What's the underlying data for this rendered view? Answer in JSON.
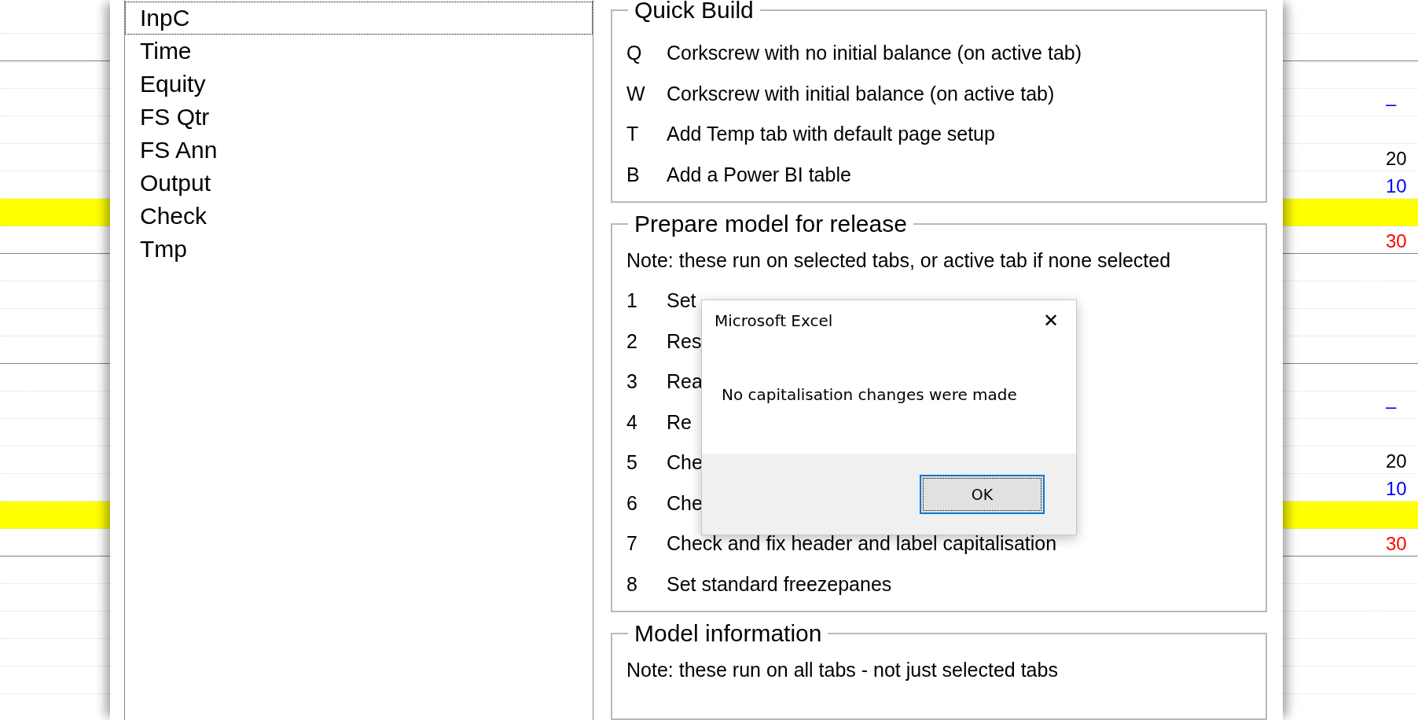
{
  "sheet": {
    "rows": [
      {
        "highlight": false,
        "rule": false
      },
      {
        "highlight": false,
        "rule": true
      },
      {
        "highlight": false,
        "rule": false
      },
      {
        "highlight": false,
        "rule": false,
        "value": "–",
        "color": "#0000ff"
      },
      {
        "highlight": false,
        "rule": false
      },
      {
        "highlight": false,
        "rule": false,
        "value": "20",
        "color": "#000000"
      },
      {
        "highlight": false,
        "rule": false,
        "value": "10",
        "color": "#0000ff"
      },
      {
        "highlight": true,
        "rule": false
      },
      {
        "highlight": false,
        "rule": true,
        "value": "30",
        "color": "#ff0000"
      },
      {
        "highlight": false,
        "rule": false
      },
      {
        "highlight": false,
        "rule": false
      },
      {
        "highlight": false,
        "rule": false
      },
      {
        "highlight": false,
        "rule": true
      },
      {
        "highlight": false,
        "rule": false
      },
      {
        "highlight": false,
        "rule": false,
        "value": "–",
        "color": "#0000ff"
      },
      {
        "highlight": false,
        "rule": false
      },
      {
        "highlight": false,
        "rule": false,
        "value": "20",
        "color": "#000000"
      },
      {
        "highlight": false,
        "rule": false,
        "value": "10",
        "color": "#0000ff"
      },
      {
        "highlight": true,
        "rule": false
      },
      {
        "highlight": false,
        "rule": true,
        "value": "30",
        "color": "#ff0000"
      },
      {
        "highlight": false,
        "rule": false
      },
      {
        "highlight": false,
        "rule": false
      },
      {
        "highlight": false,
        "rule": false
      },
      {
        "highlight": false,
        "rule": false
      },
      {
        "highlight": false,
        "rule": false
      }
    ]
  },
  "tab_list": [
    {
      "label": "InpC",
      "selected": true
    },
    {
      "label": "Time",
      "selected": false
    },
    {
      "label": "Equity",
      "selected": false
    },
    {
      "label": "FS Qtr",
      "selected": false
    },
    {
      "label": "FS Ann",
      "selected": false
    },
    {
      "label": "Output",
      "selected": false
    },
    {
      "label": "Check",
      "selected": false
    },
    {
      "label": "Tmp",
      "selected": false
    }
  ],
  "frames": [
    {
      "title": "Quick Build",
      "items": [
        {
          "key": "Q",
          "label": "Corkscrew with no initial balance (on active tab)"
        },
        {
          "key": "W",
          "label": "Corkscrew with initial balance (on active tab)"
        },
        {
          "key": "T",
          "label": "Add Temp tab with default page setup"
        },
        {
          "key": "B",
          "label": "Add a Power BI table"
        }
      ]
    },
    {
      "title": "Prepare model for release",
      "note": "Note: these run on selected tabs, or active tab if none selected",
      "items": [
        {
          "key": "1",
          "label": "Set"
        },
        {
          "key": "2",
          "label": "Res"
        },
        {
          "key": "3",
          "label": "Rea"
        },
        {
          "key": "4",
          "label": "Re"
        },
        {
          "key": "5",
          "label": "Che"
        },
        {
          "key": "6",
          "label": "Che"
        },
        {
          "key": "7",
          "label": "Check and fix header and label capitalisation"
        },
        {
          "key": "8",
          "label": "Set standard freezepanes"
        }
      ]
    },
    {
      "title": "Model information",
      "note": "Note: these run on all tabs - not just selected tabs"
    }
  ],
  "dialog": {
    "title": "Microsoft Excel",
    "close": "✕",
    "message": "No capitalisation changes were made",
    "buttons": [
      {
        "label": "OK",
        "selected": true
      }
    ]
  }
}
